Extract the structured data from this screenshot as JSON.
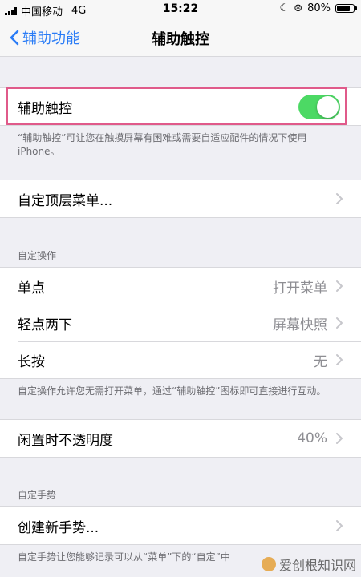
{
  "status": {
    "carrier": "中国移动",
    "network": "4G",
    "time": "15:22",
    "battery": "80%",
    "battery_level": 0.8
  },
  "nav": {
    "back_label": "辅助功能",
    "title": "辅助触控"
  },
  "main_toggle": {
    "label": "辅助触控",
    "on": true,
    "accent": "#4cd964",
    "footer": "“辅助触控”可让您在触摸屏幕有困难或需要自适应配件的情况下使用 iPhone。"
  },
  "top_menu": {
    "label": "自定顶层菜单..."
  },
  "custom_actions": {
    "header": "自定操作",
    "rows": [
      {
        "label": "单点",
        "value": "打开菜单"
      },
      {
        "label": "轻点两下",
        "value": "屏幕快照"
      },
      {
        "label": "长按",
        "value": "无"
      }
    ],
    "footer": "自定操作允许您无需打开菜单，通过“辅助触控”图标即可直接进行互动。"
  },
  "idle_opacity": {
    "label": "闲置时不透明度",
    "value": "40%"
  },
  "custom_gestures": {
    "header": "自定手势",
    "new_label": "创建新手势...",
    "footer": "自定手势让您能够记录可以从“菜单”下的“自定”中"
  },
  "watermark": "爱创根知识网",
  "colors": {
    "link": "#2a7cf6",
    "highlight": "#e05a8a",
    "background": "#efeff4"
  }
}
